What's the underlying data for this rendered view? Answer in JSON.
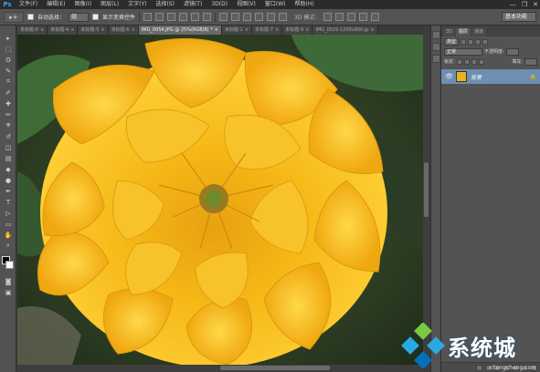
{
  "app": {
    "logo": "Ps"
  },
  "menu": [
    "文件(F)",
    "编辑(E)",
    "图像(I)",
    "图层(L)",
    "文字(Y)",
    "选择(S)",
    "滤镜(T)",
    "3D(D)",
    "视图(V)",
    "窗口(W)",
    "帮助(H)"
  ],
  "window_controls": {
    "minimize": "—",
    "restore": "❐",
    "close": "✕"
  },
  "options": {
    "tool_glyph": "▸+",
    "auto_select_label": "自动选择：",
    "auto_select_value": "组",
    "show_transform_label": "显示变换控件",
    "mode_3d_label": "3D 模式：",
    "workspace": "基本功能"
  },
  "tools": [
    "move-tool-icon",
    "marquee-tool-icon",
    "lasso-tool-icon",
    "quick-select-tool-icon",
    "crop-tool-icon",
    "eyedropper-tool-icon",
    "healing-brush-icon",
    "brush-tool-icon",
    "clone-stamp-icon",
    "history-brush-icon",
    "eraser-tool-icon",
    "gradient-tool-icon",
    "blur-tool-icon",
    "dodge-tool-icon",
    "pen-tool-icon",
    "type-tool-icon",
    "path-select-icon",
    "shape-tool-icon",
    "hand-tool-icon",
    "zoom-tool-icon"
  ],
  "tool_glyphs": [
    "▸",
    "⬚",
    "ʘ",
    "✎",
    "⌗",
    "✐",
    "✚",
    "✏",
    "⎈",
    "↺",
    "◫",
    "▤",
    "◆",
    "●",
    "✒",
    "T",
    "▷",
    "▭",
    "✋",
    "⌕"
  ],
  "tabs": [
    {
      "label": "未标题-8",
      "active": false
    },
    {
      "label": "未标题-4",
      "active": false
    },
    {
      "label": "未标题-5",
      "active": false
    },
    {
      "label": "未标题-6",
      "active": false
    },
    {
      "label": "IMG_0054.JPG @ 25%(RGB/8) *",
      "active": true
    },
    {
      "label": "未标题-1",
      "active": false
    },
    {
      "label": "未标题-7",
      "active": false
    },
    {
      "label": "未标题-9",
      "active": false
    },
    {
      "label": "IMG_0025-1200x900.jp",
      "active": false
    }
  ],
  "tab_close": "×",
  "layers_panel": {
    "tabs": [
      "3D",
      "图层",
      "通道"
    ],
    "active_tab": "图层",
    "filter_kind": "类型",
    "blend_mode": "正常",
    "opacity_label": "不透明度:",
    "lock_label": "锁定:",
    "fill_label": "填充:",
    "layer": {
      "name": "背景",
      "visible_glyph": "👁",
      "lock_glyph": "🔒"
    }
  },
  "watermark": {
    "brand": "系统城",
    "url": "xitongcheng.com"
  },
  "colors": {
    "accent": "#31a8ff",
    "selected_layer": "#6d8fb0",
    "flower": "#f2b313"
  }
}
